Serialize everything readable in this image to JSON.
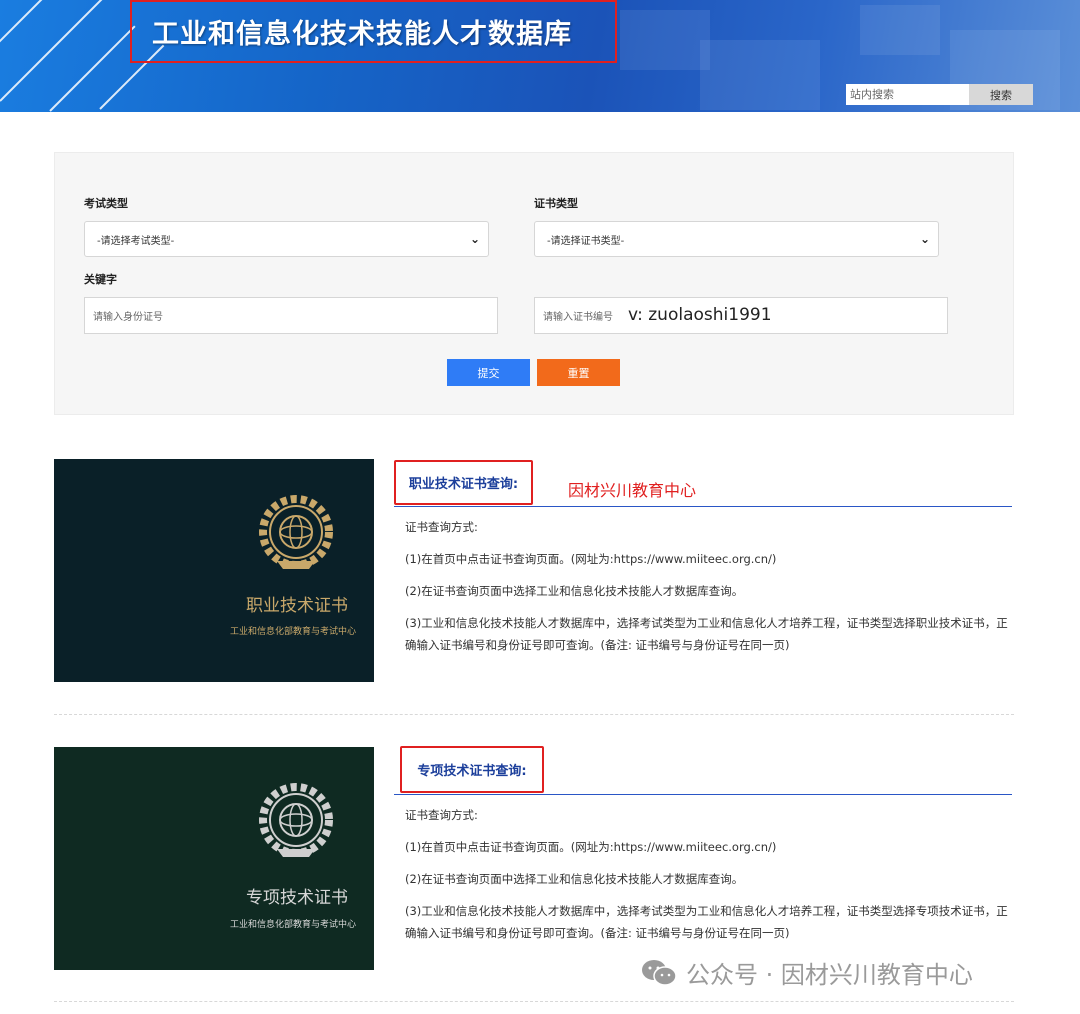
{
  "header": {
    "title": "工业和信息化技术技能人才数据库",
    "search_placeholder": "站内搜索",
    "search_button": "搜索"
  },
  "form": {
    "exam_type_label": "考试类型",
    "exam_type_value": "-请选择考试类型-",
    "cert_type_label": "证书类型",
    "cert_type_value": "-请选择证书类型-",
    "keyword_label": "关键字",
    "id_placeholder": "请输入身份证号",
    "cert_no_placeholder": "请输入证书编号",
    "watermark": "v:  zuolaoshi1991",
    "submit": "提交",
    "reset": "重置"
  },
  "sections": [
    {
      "heading": "职业技术证书查询:",
      "promo": "因材兴川教育中心",
      "image_title": "职业技术证书",
      "image_sub": "工业和信息化部教育与考试中心",
      "intro": "证书查询方式:",
      "step1": "(1)在首页中点击证书查询页面。(网址为:https://www.miiteec.org.cn/)",
      "step2": "(2)在证书查询页面中选择工业和信息化技术技能人才数据库查询。",
      "step3": "(3)工业和信息化技术技能人才数据库中，选择考试类型为工业和信息化人才培养工程，证书类型选择职业技术证书，正确输入证书编号和身份证号即可查询。(备注: 证书编号与身份证号在同一页)"
    },
    {
      "heading": "专项技术证书查询:",
      "image_title": "专项技术证书",
      "image_sub": "工业和信息化部教育与考试中心",
      "intro": "证书查询方式:",
      "step1": "(1)在首页中点击证书查询页面。(网址为:https://www.miiteec.org.cn/)",
      "step2": "(2)在证书查询页面中选择工业和信息化技术技能人才数据库查询。",
      "step3": "(3)工业和信息化技术技能人才数据库中，选择考试类型为工业和信息化人才培养工程，证书类型选择专项技术证书，正确输入证书编号和身份证号即可查询。(备注: 证书编号与身份证号在同一页)"
    }
  ],
  "footer": {
    "watermark": "公众号 · 因材兴川教育中心"
  }
}
